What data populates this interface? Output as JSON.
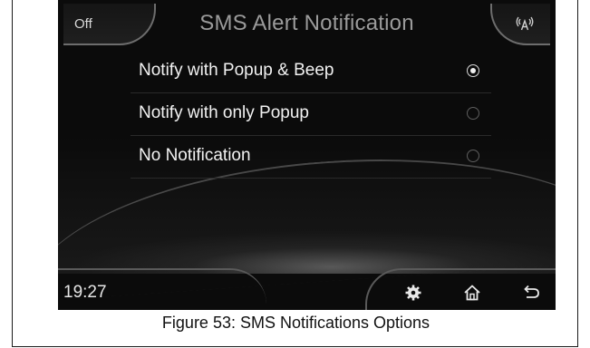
{
  "header": {
    "off_label": "Off",
    "title": "SMS Alert Notification",
    "signal_icon": "signal-icon"
  },
  "options": [
    {
      "label": "Notify with Popup & Beep",
      "selected": true
    },
    {
      "label": "Notify with only Popup",
      "selected": false
    },
    {
      "label": "No Notification",
      "selected": false
    }
  ],
  "footer": {
    "time": "19:27",
    "icons": [
      "settings-icon",
      "home-icon",
      "back-icon"
    ]
  },
  "caption": "Figure 53: SMS Notifications Options"
}
